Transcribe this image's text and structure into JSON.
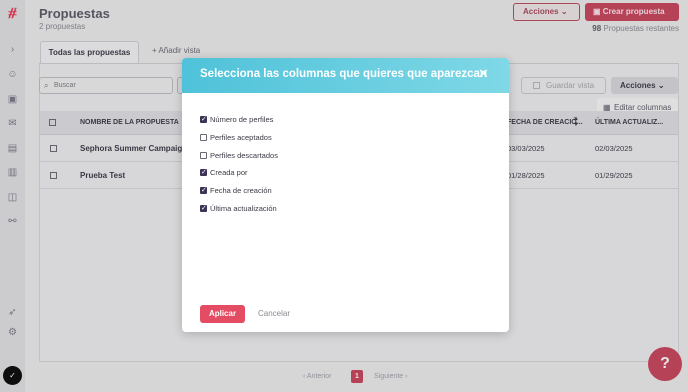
{
  "header": {
    "title": "Propuestas",
    "subtitle": "2 propuestas",
    "actions_label": "Acciones",
    "create_label": "Crear propuesta",
    "remaining_count": "98",
    "remaining_label": "Propuestas restantes"
  },
  "tabs": {
    "all_label": "Todas las propuestas",
    "add_label": "Añadir vista"
  },
  "toolbar": {
    "search_placeholder": "Buscar",
    "save_view_label": "Guardar vista",
    "actions_label": "Acciones",
    "edit_columns_label": "Editar columnas"
  },
  "table": {
    "headers": {
      "name": "NOMBRE DE LA PROPUESTA",
      "created": "FECHA DE CREACIÓ...",
      "updated": "ÚLTIMA ACTUALIZ..."
    },
    "rows": [
      {
        "name": "Sephora Summer Campaign",
        "created": "03/03/2025",
        "updated": "02/03/2025"
      },
      {
        "name": "Prueba Test",
        "created": "01/28/2025",
        "updated": "01/29/2025"
      }
    ]
  },
  "pagination": {
    "prev_label": "Anterior",
    "current_page": "1",
    "next_label": "Siguiente"
  },
  "modal": {
    "title": "Selecciona las columnas que quieres que aparezcan",
    "options": [
      {
        "label": "Número de perfiles",
        "checked": true
      },
      {
        "label": "Perfiles aceptados",
        "checked": false
      },
      {
        "label": "Perfiles descartados",
        "checked": false
      },
      {
        "label": "Creada por",
        "checked": true
      },
      {
        "label": "Fecha de creación",
        "checked": true
      },
      {
        "label": "Última actualización",
        "checked": true
      }
    ],
    "apply_label": "Aplicar",
    "cancel_label": "Cancelar"
  },
  "colors": {
    "accent": "#e34c63",
    "modal_header_start": "#4fc2d9",
    "modal_header_end": "#7fd8e6",
    "checkbox_checked": "#3d3357"
  }
}
